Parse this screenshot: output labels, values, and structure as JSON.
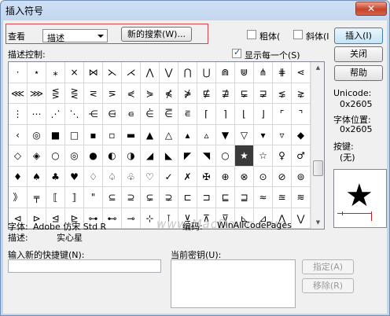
{
  "window": {
    "title": "插入符号",
    "close_glyph": "✕"
  },
  "view": {
    "label": "查看",
    "selected": "描述",
    "search_button": "新的搜索(W)..."
  },
  "options": {
    "bold_label": "粗体(",
    "italic_label": "斜体(I"
  },
  "buttons": {
    "insert": "插入(I)",
    "close": "关闭",
    "help": "帮助"
  },
  "grid_header": {
    "label": "描述控制:",
    "show_each_label": "显示每一个(S)",
    "show_each_checked": true
  },
  "grid": {
    "rows": [
      [
        "·",
        "⋆",
        "⁎",
        "×",
        "⋈",
        "⋋",
        "⋌",
        "⋀",
        "⋁",
        "⋂",
        "⋃",
        "⋒",
        "⋓",
        "⋔",
        "⋕",
        "⋖"
      ],
      [
        "⋘",
        "⋙",
        "⋚",
        "⋛",
        "⋜",
        "⋝",
        "⋞",
        "⋟",
        "⋠",
        "⋡",
        "⋢",
        "⋣",
        "⋤",
        "⋥",
        "⋦",
        "⋧"
      ],
      [
        "⋮",
        "⋯",
        "⋰",
        "⋱",
        "⋲",
        "⋳",
        "⋴",
        "⋵",
        "⋶",
        "⋷",
        "⌈",
        "⌉",
        "⌊",
        "⌋",
        "⌜",
        "⌝"
      ],
      [
        "‹",
        "◎",
        "■",
        "□",
        "▪",
        "▫",
        "▬",
        "▲",
        "△",
        "▴",
        "▵",
        "▼",
        "▽",
        "▾",
        "▿",
        "◆"
      ],
      [
        "◇",
        "◈",
        "○",
        "◎",
        "●",
        "◐",
        "◑",
        "◢",
        "◣",
        "◤",
        "◥",
        "○",
        "★",
        "☆",
        "♀",
        "♂"
      ],
      [
        "♦",
        "♠",
        "♣",
        "♥",
        "♢",
        "♤",
        "♧",
        "♡",
        "✓",
        "✗",
        "✠",
        "⊕",
        "⊗",
        "⊙",
        "⊘",
        "⊚"
      ],
      [
        "》",
        "╤",
        "⟦",
        "⟧",
        "\"",
        "⊆",
        "⊇",
        "⊊",
        "⊋",
        "⊏",
        "⊐",
        "⊑",
        "⊒",
        "≈",
        "≊",
        "≋"
      ],
      [
        "⊲",
        "⊳",
        "⊴",
        "⊵",
        "⊶",
        "⊷",
        "⊸",
        "⊹",
        "⊺",
        "⊻",
        "⊼",
        "⊽",
        "⊾",
        "⊿",
        "⋀",
        "⋁"
      ]
    ],
    "selected": {
      "row": 4,
      "col": 12
    }
  },
  "watermark": "www.MacDown.com",
  "info": {
    "unicode_label": "Unicode:",
    "unicode_value": "0x2605",
    "fontpos_label": "字体位置:",
    "fontpos_value": "0x2605",
    "keys_label": "按键:",
    "keys_value": "(无)",
    "font_label": "字体:",
    "font_value": "Adobe 仿宋 Std R",
    "encoding_label": "编码:",
    "encoding_value": "WinAllCodePages",
    "desc_label": "描述:",
    "desc_value": "实心星"
  },
  "shortcut": {
    "new_key_label": "输入新的快捷键(N):",
    "current_key_label": "当前密钥(U):",
    "assign_button": "指定(A)",
    "remove_button": "移除(R)"
  },
  "preview": {
    "glyph": "★"
  },
  "colors": {
    "highlight": "#d9444c",
    "window_frame": "#c2d6ee",
    "selected_cell": "#3a3a3a"
  }
}
